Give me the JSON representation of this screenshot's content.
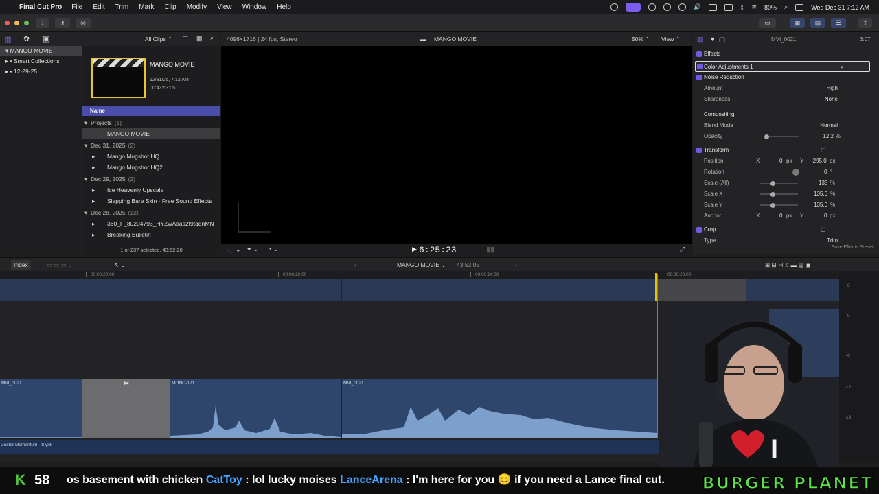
{
  "menubar": {
    "app_name": "Final Cut Pro",
    "items": [
      "File",
      "Edit",
      "Trim",
      "Mark",
      "Clip",
      "Modify",
      "View",
      "Window",
      "Help"
    ],
    "battery": "80%",
    "datetime": "Wed Dec 31  7:12 AM"
  },
  "browser": {
    "filter": "All Clips",
    "libraries": [
      {
        "label": "MANGO MOVIE",
        "selected": true
      },
      {
        "label": "Smart Collections"
      },
      {
        "label": "12-29-25"
      }
    ],
    "project_card": {
      "title": "MANGO MOVIE",
      "date": "12/31/25, 7:12 AM",
      "duration": "00:43:53:05"
    },
    "column_header": "Name",
    "rows": [
      {
        "text": "Projects",
        "count": "(1)",
        "type": "group"
      },
      {
        "text": "MANGO MOVIE",
        "type": "item",
        "selected": true
      },
      {
        "text": "Dec 31, 2025",
        "count": "(2)",
        "type": "group"
      },
      {
        "text": "Mango Mugshot HQ",
        "type": "item"
      },
      {
        "text": "Mango Mugshot HQ2",
        "type": "item"
      },
      {
        "text": "Dec 29, 2025",
        "count": "(2)",
        "type": "group"
      },
      {
        "text": "Ice Heavenly Upscale",
        "type": "item"
      },
      {
        "text": "Slapping Bare Skin - Free Sound Effects",
        "type": "item"
      },
      {
        "text": "Dec 28, 2025",
        "count": "(12)",
        "type": "group"
      },
      {
        "text": "360_F_80204793_HYZwAaas2f9tqqnMN",
        "type": "item"
      },
      {
        "text": "Breaking Bulletin",
        "type": "item"
      }
    ],
    "status": "1 of 237 selected, 43:52:20"
  },
  "viewer": {
    "format": "4096×1716 | 24 fps, Stereo",
    "title": "MANGO MOVIE",
    "zoom": "50%",
    "view_label": "View",
    "timecode": "6:25:23"
  },
  "inspector": {
    "clip_name": "MVI_0021",
    "duration": "3:07",
    "effects_label": "Effects",
    "color_adjust": "Color Adjustments 1",
    "noise_reduction": "Noise Reduction",
    "amount_label": "Amount",
    "amount_value": "High",
    "sharpness_label": "Sharpness",
    "sharpness_value": "None",
    "compositing_label": "Compositing",
    "blend_label": "Blend Mode",
    "blend_value": "Normal",
    "opacity_label": "Opacity",
    "opacity_value": "12.2",
    "opacity_unit": "%",
    "transform_label": "Transform",
    "position_label": "Position",
    "position_x": "0",
    "position_y": "-295.0",
    "rotation_label": "Rotation",
    "rotation_value": "0",
    "rotation_unit": "°",
    "scale_all_label": "Scale (All)",
    "scale_all_value": "135",
    "scale_x_label": "Scale X",
    "scale_x_value": "135.0",
    "scale_y_label": "Scale Y",
    "scale_y_value": "135.0",
    "anchor_label": "Anchor",
    "anchor_x": "0",
    "anchor_y": "0",
    "crop_label": "Crop",
    "type_label": "Type",
    "type_value": "Trim",
    "save_preset": "Save Effects Preset",
    "x_label": "X",
    "y_label": "Y",
    "px": "px",
    "pct": "%"
  },
  "timeline": {
    "index_label": "Index",
    "project": "MANGO MOVIE",
    "duration": "43:53:05",
    "ruler": [
      "00:06:20:00",
      "00:06:22:00",
      "00:06:24:00",
      "00:06:26:00"
    ],
    "clips": [
      "MVI_0021",
      "MONO-121",
      "MVI_0021"
    ],
    "music": "Doctor Momentum - Slynk",
    "meter_marks": [
      "6",
      "0",
      "-6",
      "-12",
      "-18"
    ]
  },
  "ticker": {
    "kick_letter": "K",
    "kick_count": "58",
    "segments": [
      {
        "text": "os basement with chicken  ",
        "user": false
      },
      {
        "text": "CatToy",
        "user": true
      },
      {
        "text": " : lol lucky moises  ",
        "user": false
      },
      {
        "text": "LanceArena",
        "user": true
      },
      {
        "text": " : I'm here for you 😊 if you need a Lance final cut.",
        "user": false
      }
    ],
    "brand": "BURGER PLANET"
  },
  "colors": {
    "accent": "#6c5ce7",
    "playhead": "#e0583e",
    "clip": "#2e466b",
    "kick": "#4ec63a"
  }
}
